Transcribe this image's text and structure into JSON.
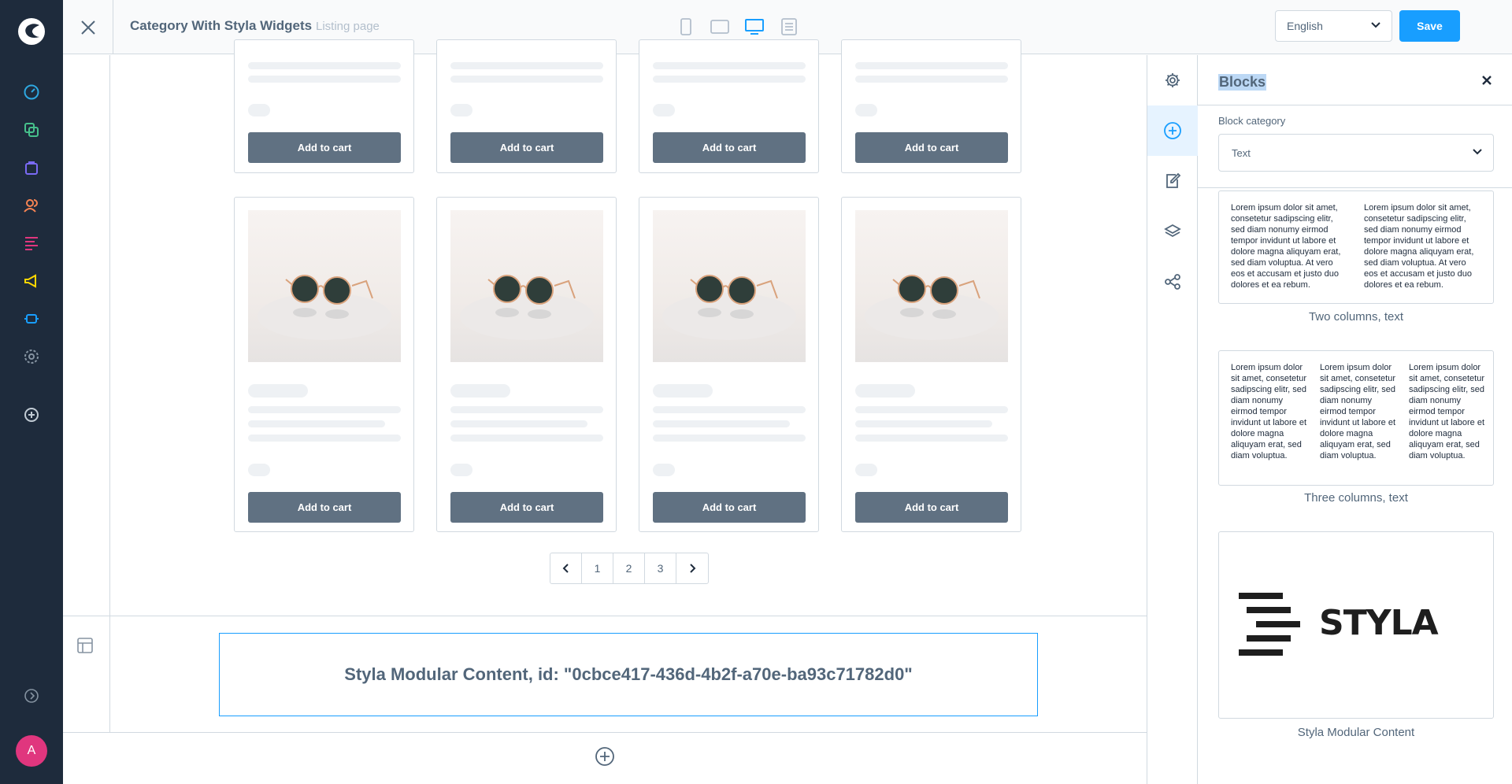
{
  "header": {
    "title": "Category With Styla Widgets",
    "subtitle": "Listing page",
    "language": "English",
    "save_label": "Save"
  },
  "avatar": {
    "initial": "A"
  },
  "listing": {
    "add_to_cart_label": "Add to cart",
    "pagination": [
      "1",
      "2",
      "3"
    ]
  },
  "styla_block": {
    "text": "Styla Modular Content, id: \"0cbce417-436d-4b2f-a70e-ba93c71782d0\""
  },
  "blocks_panel": {
    "title": "Blocks",
    "category_label": "Block category",
    "category_value": "Text",
    "lorem_long": "Lorem ipsum dolor sit amet, consetetur sadipscing elitr, sed diam nonumy eirmod tempor invidunt ut labore et dolore magna aliquyam erat, sed diam voluptua. At vero eos et accusam et justo duo dolores et ea rebum.",
    "lorem_short": "Lorem ipsum dolor sit amet, consetetur sadipscing elitr, sed diam nonumy eirmod tempor invidunt ut labore et dolore magna aliquyam erat, sed diam voluptua.",
    "blocks": [
      {
        "caption": "Two columns, text"
      },
      {
        "caption": "Three columns, text"
      },
      {
        "caption": "Styla Modular Content",
        "logo_text": "STYLA"
      }
    ]
  },
  "colors": {
    "nav_bg": "#1e2b3c",
    "accent": "#189eff",
    "button_gray": "#607182",
    "avatar": "#e0367e"
  }
}
